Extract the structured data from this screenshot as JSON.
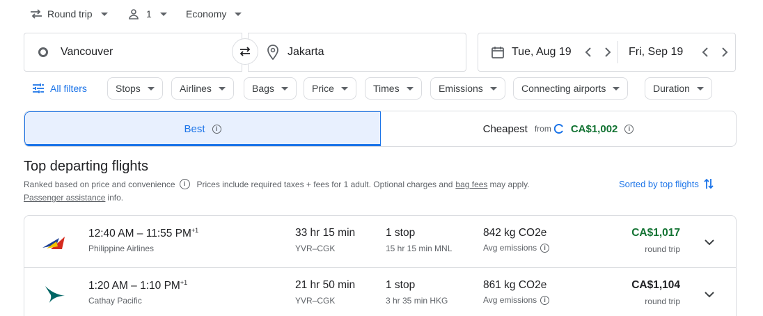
{
  "top_bar": {
    "trip_type": "Round trip",
    "passengers": "1",
    "cabin": "Economy"
  },
  "search": {
    "origin": "Vancouver",
    "destination": "Jakarta",
    "depart_date": "Tue, Aug 19",
    "return_date": "Fri, Sep 19"
  },
  "filters": {
    "all_filters": "All filters",
    "chips": [
      "Stops",
      "Airlines",
      "Bags",
      "Price",
      "Times",
      "Emissions",
      "Connecting airports",
      "Duration"
    ]
  },
  "tabs": {
    "best": "Best",
    "cheapest": "Cheapest",
    "from_label": "from",
    "cheapest_price": "CA$1,002"
  },
  "section": {
    "title": "Top departing flights",
    "ranked_text": "Ranked based on price and convenience",
    "prices_text_a": "Prices include required taxes + fees for 1 adult. Optional charges and",
    "bag_fees_link": "bag fees",
    "prices_text_b": "may apply.",
    "passenger_link": "Passenger assistance",
    "info_text": "info.",
    "sort_label": "Sorted by top flights"
  },
  "flights": [
    {
      "times": "12:40 AM – 11:55 PM",
      "day_offset": "+1",
      "airline": "Philippine Airlines",
      "duration": "33 hr 15 min",
      "route": "YVR–CGK",
      "stops": "1 stop",
      "stop_detail": "15 hr 15 min MNL",
      "emissions": "842 kg CO2e",
      "emissions_label": "Avg emissions",
      "price": "CA$1,017",
      "price_type": "round trip",
      "price_color": "#137333",
      "logo": "philippine-airlines-logo"
    },
    {
      "times": "1:20 AM – 1:10 PM",
      "day_offset": "+1",
      "airline": "Cathay Pacific",
      "duration": "21 hr 50 min",
      "route": "YVR–CGK",
      "stops": "1 stop",
      "stop_detail": "3 hr 35 min HKG",
      "emissions": "861 kg CO2e",
      "emissions_label": "Avg emissions",
      "price": "CA$1,104",
      "price_type": "round trip",
      "price_color": "#202124",
      "logo": "cathay-pacific-logo"
    }
  ],
  "colors": {
    "accent": "#1a73e8",
    "good_price": "#137333"
  }
}
